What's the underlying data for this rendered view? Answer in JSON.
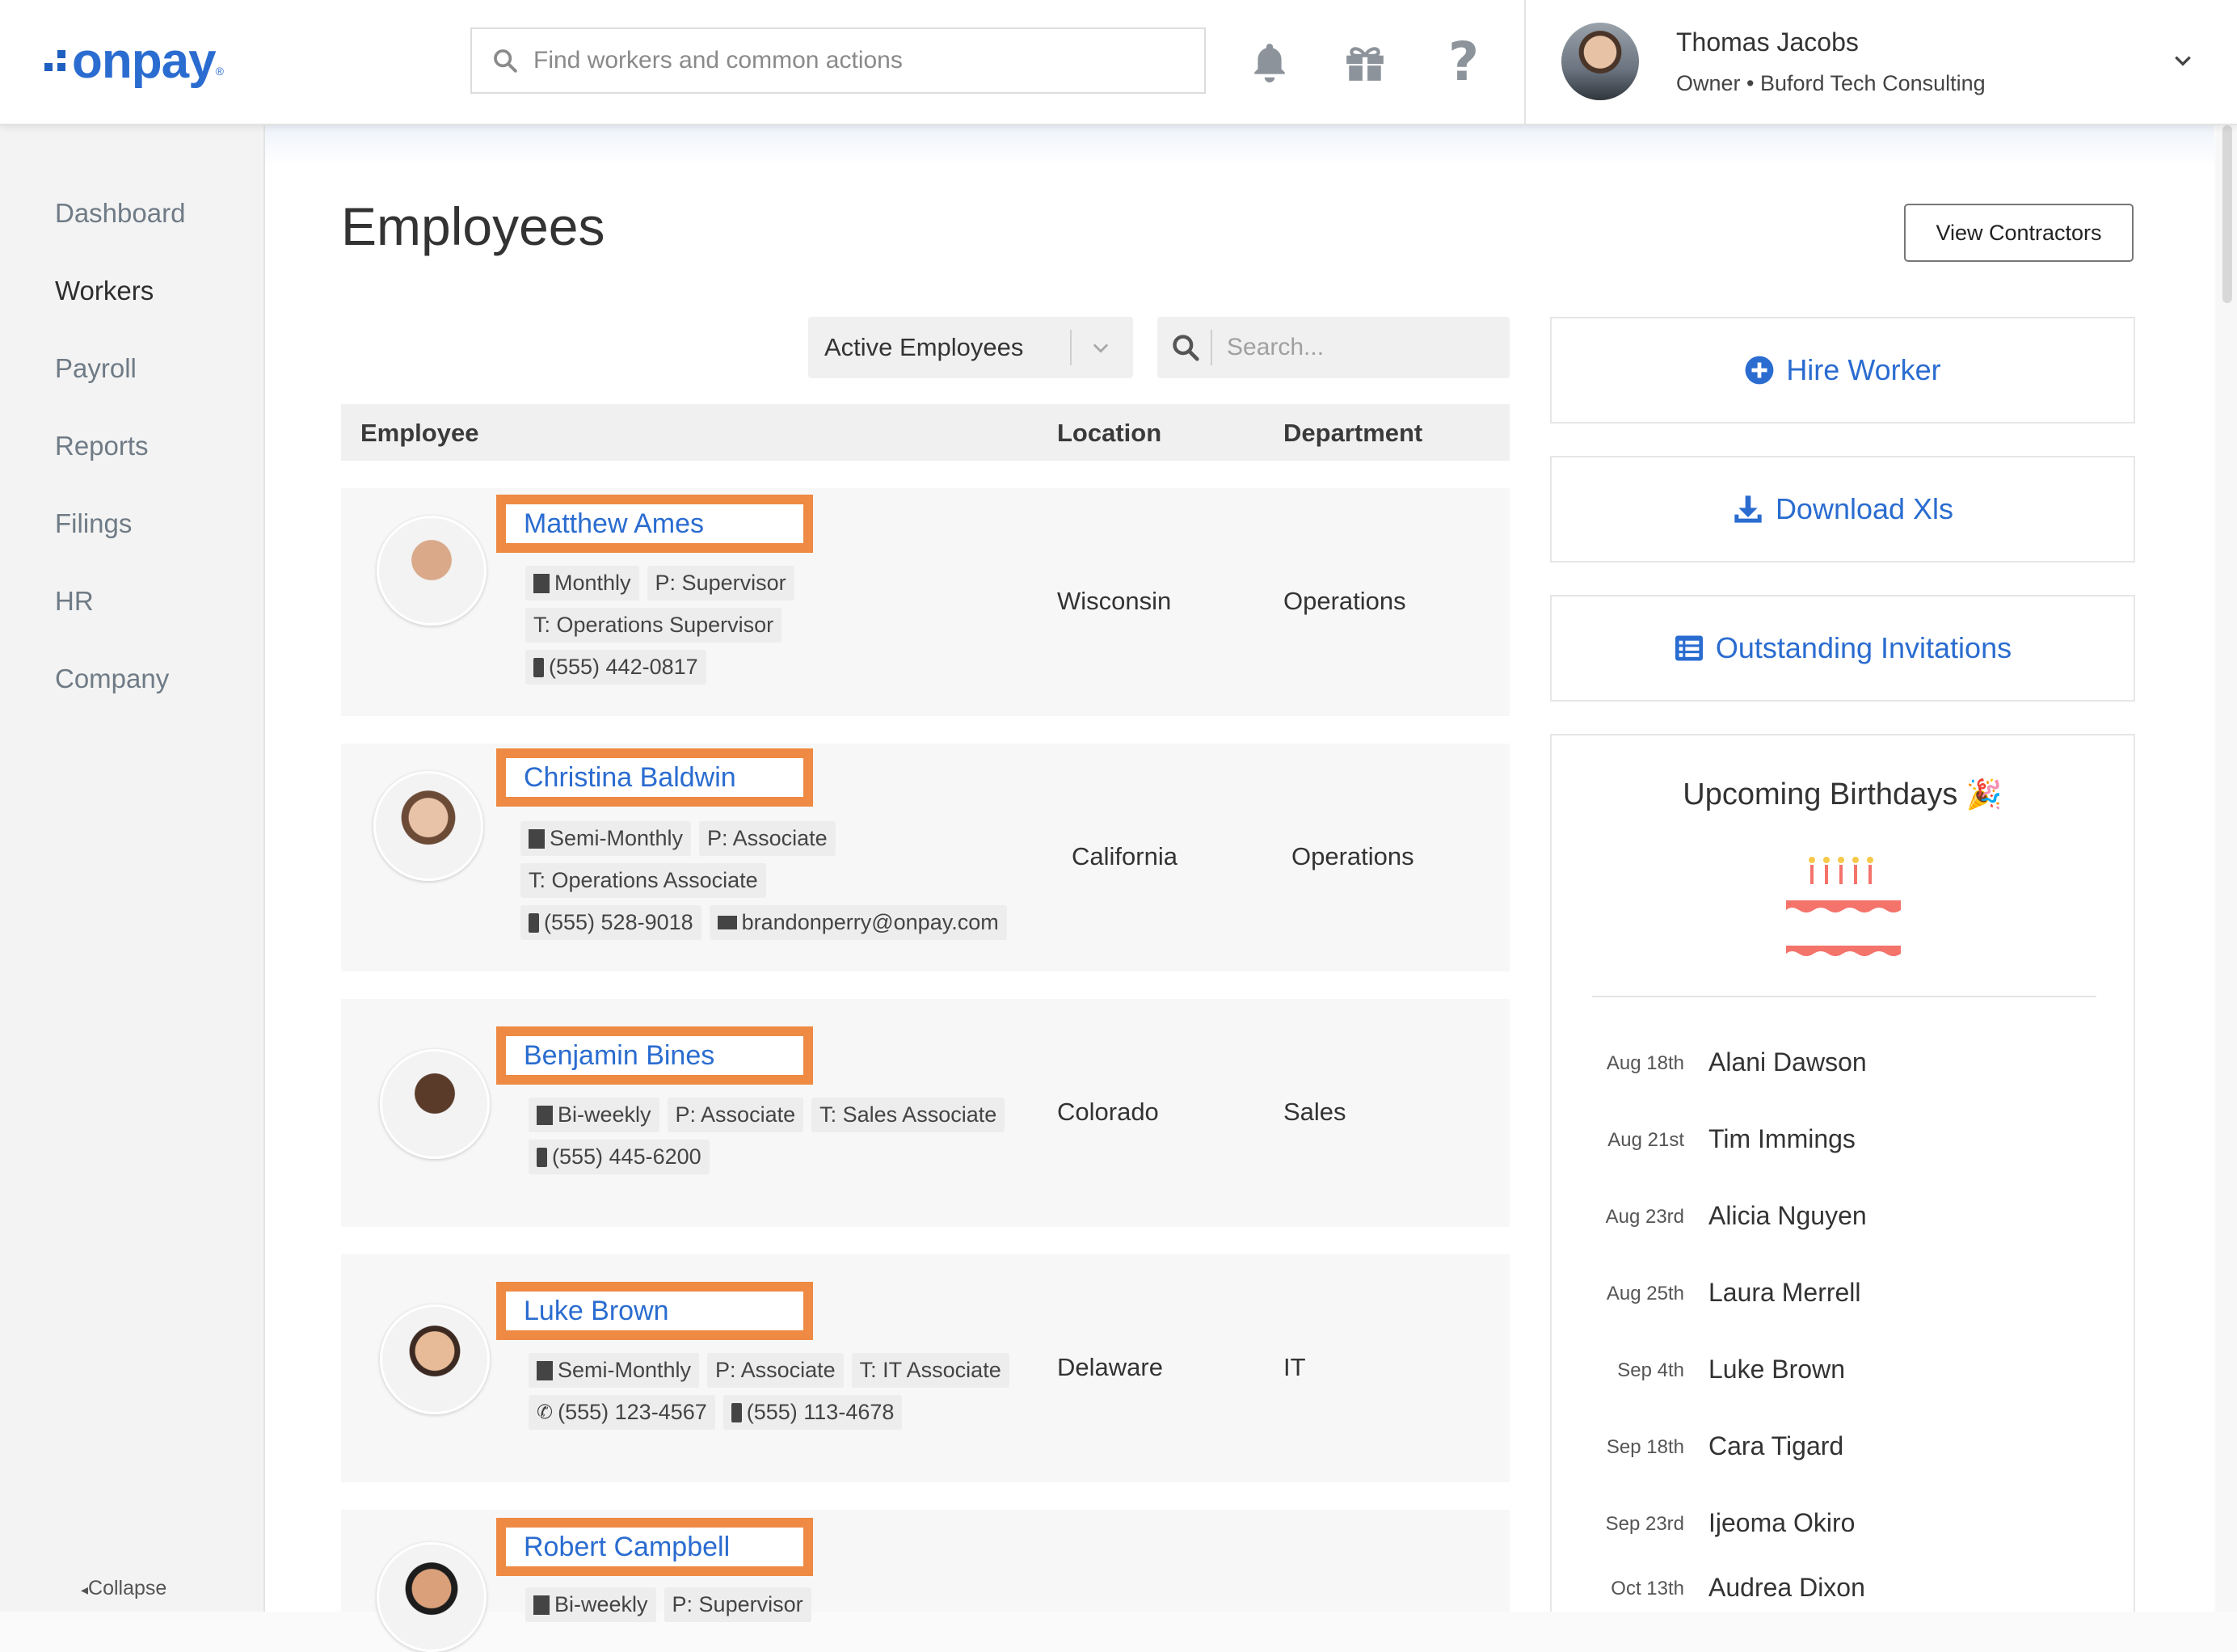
{
  "header": {
    "logo_text": "onpay",
    "logo_reg": "®",
    "search_placeholder": "Find workers and common actions",
    "icons": [
      "bell-icon",
      "gift-icon",
      "help-icon"
    ],
    "user_name": "Thomas Jacobs",
    "user_role": "Owner • Buford Tech Consulting"
  },
  "sidebar": {
    "items": [
      {
        "label": "Dashboard",
        "active": false
      },
      {
        "label": "Workers",
        "active": true
      },
      {
        "label": "Payroll",
        "active": false
      },
      {
        "label": "Reports",
        "active": false
      },
      {
        "label": "Filings",
        "active": false
      },
      {
        "label": "HR",
        "active": false
      },
      {
        "label": "Company",
        "active": false
      }
    ],
    "collapse_label": "Collapse"
  },
  "main": {
    "title": "Employees",
    "view_contractors_label": "View Contractors",
    "filter_value": "Active Employees",
    "search_placeholder": "Search...",
    "columns": {
      "employee": "Employee",
      "location": "Location",
      "department": "Department"
    }
  },
  "employees": [
    {
      "name": "Matthew Ames",
      "pay": "Monthly",
      "position": "P: Supervisor",
      "title": "T: Operations Supervisor",
      "mobile": "(555) 442-0817",
      "location": "Wisconsin",
      "department": "Operations"
    },
    {
      "name": "Christina Baldwin",
      "pay": "Semi-Monthly",
      "position": "P: Associate",
      "title": "T: Operations Associate",
      "mobile": "(555) 528-9018",
      "email": "brandonperry@onpay.com",
      "location": "California",
      "department": "Operations"
    },
    {
      "name": "Benjamin Bines",
      "pay": "Bi-weekly",
      "position": "P: Associate",
      "title": "T: Sales Associate",
      "mobile": "(555) 445-6200",
      "location": "Colorado",
      "department": "Sales"
    },
    {
      "name": "Luke Brown",
      "pay": "Semi-Monthly",
      "position": "P: Associate",
      "title": "T: IT Associate",
      "phone": "(555) 123-4567",
      "mobile": "(555) 113-4678",
      "location": "Delaware",
      "department": "IT"
    },
    {
      "name": "Robert Campbell",
      "pay": "Bi-weekly",
      "position": "P: Supervisor"
    }
  ],
  "actions": {
    "hire": "Hire Worker",
    "download": "Download Xls",
    "invitations": "Outstanding Invitations"
  },
  "birthdays": {
    "title": "Upcoming Birthdays",
    "items": [
      {
        "date": "Aug 18th",
        "name": "Alani Dawson"
      },
      {
        "date": "Aug 21st",
        "name": "Tim Immings"
      },
      {
        "date": "Aug 23rd",
        "name": "Alicia Nguyen"
      },
      {
        "date": "Aug 25th",
        "name": "Laura Merrell"
      },
      {
        "date": "Sep 4th",
        "name": "Luke Brown"
      },
      {
        "date": "Sep 18th",
        "name": "Cara Tigard"
      },
      {
        "date": "Sep 23rd",
        "name": "Ijeoma Okiro"
      },
      {
        "date": "Oct 13th",
        "name": "Audrea Dixon"
      }
    ]
  },
  "colors": {
    "brand": "#2a6cd0",
    "highlight": "#ee8a43",
    "cake": "#f4736b"
  }
}
